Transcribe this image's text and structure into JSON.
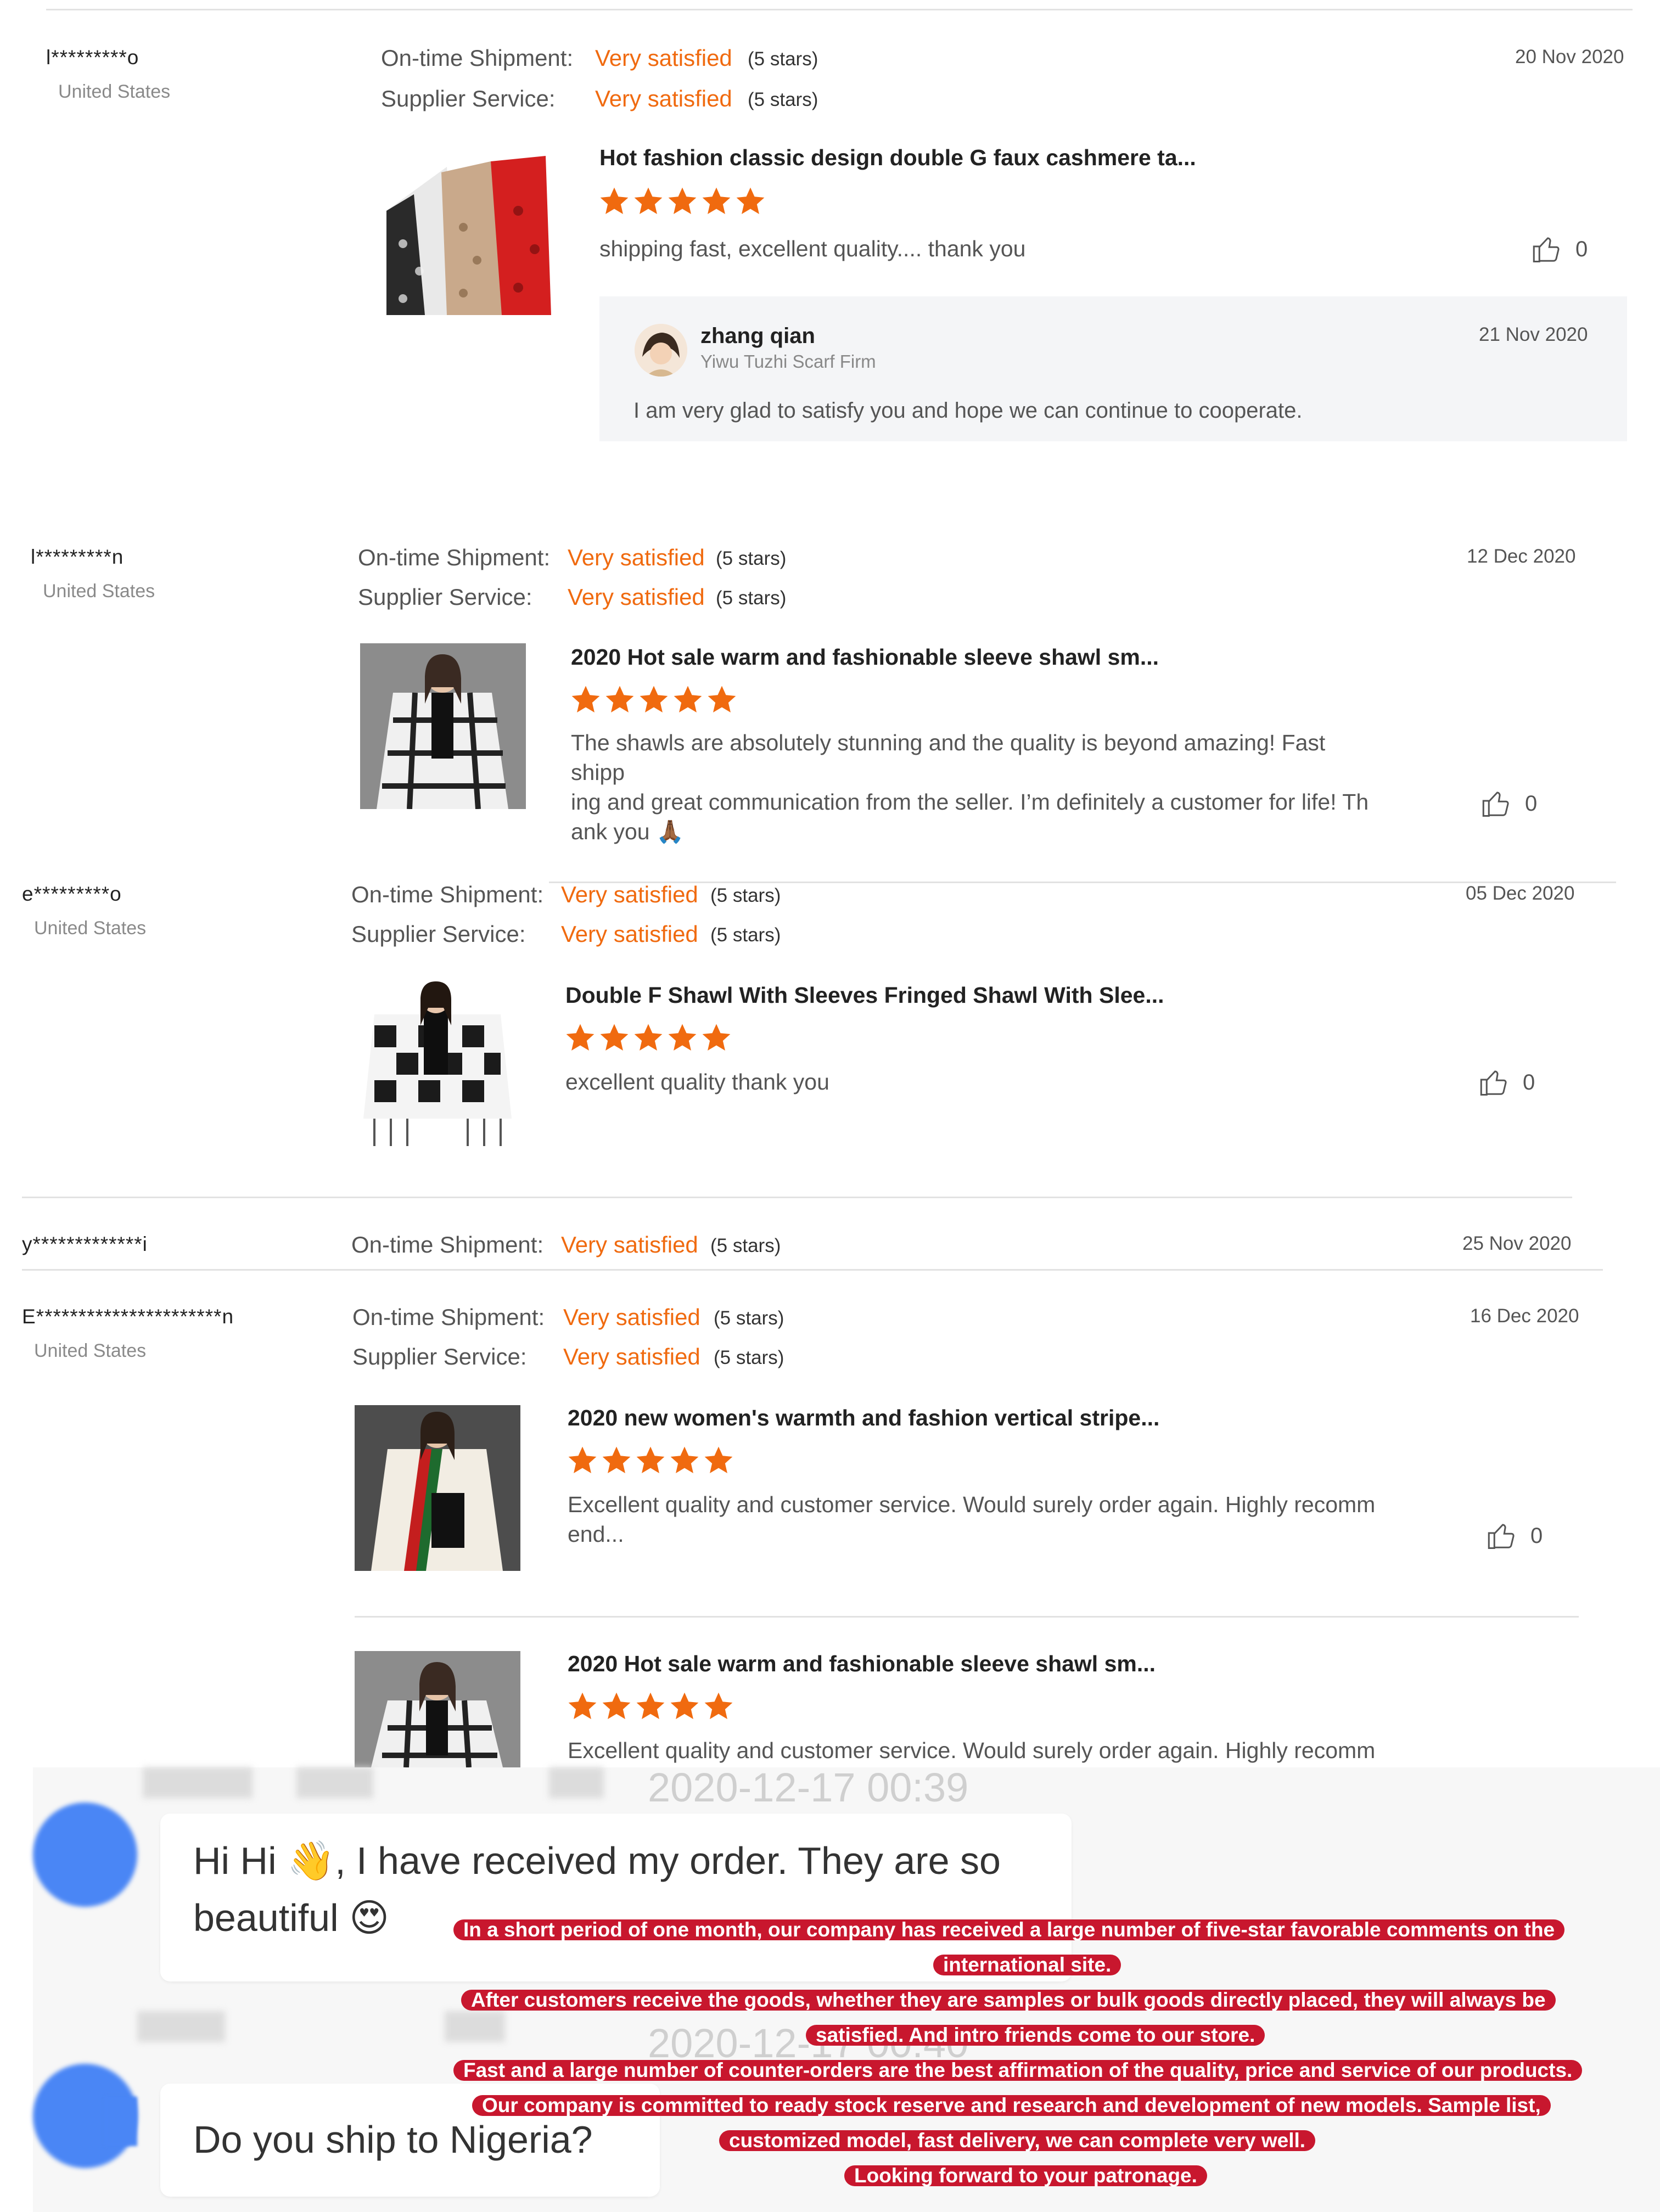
{
  "reviews": [
    {
      "user": "l*********o",
      "country": "United States",
      "date": "20 Nov 2020",
      "ontime_label": "On-time Shipment:",
      "ontime_value": "Very satisfied",
      "ontime_stars": "(5 stars)",
      "service_label": "Supplier Service:",
      "service_value": "Very satisfied",
      "service_stars": "(5 stars)",
      "product_title": "Hot fashion classic design double G faux cashmere ta...",
      "rating": 5,
      "comment": "shipping fast, excellent quality.... thank you",
      "likes": "0",
      "reply": {
        "name": "zhang qian",
        "company": "Yiwu Tuzhi Scarf Firm",
        "date": "21 Nov 2020",
        "text": "I am very glad to satisfy you and hope we can continue to cooperate."
      }
    },
    {
      "user": "l*********n",
      "country": "United States",
      "date": "12 Dec 2020",
      "ontime_label": "On-time Shipment:",
      "ontime_value": "Very satisfied",
      "ontime_stars": "(5 stars)",
      "service_label": "Supplier Service:",
      "service_value": "Very satisfied",
      "service_stars": "(5 stars)",
      "product_title": "2020 Hot sale warm and fashionable sleeve shawl sm...",
      "rating": 5,
      "comment_lines": [
        "The shawls are absolutely stunning and the quality is beyond amazing! Fast shipp",
        "ing and great communication from the seller. I’m definitely a customer for life! Th",
        "ank you 🙏🏾"
      ],
      "likes": "0"
    },
    {
      "user": "e*********o",
      "country": "United States",
      "date": "05 Dec 2020",
      "ontime_label": "On-time Shipment:",
      "ontime_value": "Very satisfied",
      "ontime_stars": "(5 stars)",
      "service_label": "Supplier Service:",
      "service_value": "Very satisfied",
      "service_stars": "(5 stars)",
      "product_title": "Double F Shawl With Sleeves Fringed Shawl With Slee...",
      "rating": 5,
      "comment": "excellent quality thank you",
      "likes": "0"
    },
    {
      "user": "y*************i",
      "date": "25 Nov 2020",
      "ontime_label": "On-time Shipment:",
      "ontime_value": "Very satisfied",
      "ontime_stars": "(5 stars)"
    },
    {
      "user": "E**********************n",
      "country": "United States",
      "date": "16 Dec 2020",
      "ontime_label": "On-time Shipment:",
      "ontime_value": "Very satisfied",
      "ontime_stars": "(5 stars)",
      "service_label": "Supplier Service:",
      "service_value": "Very satisfied",
      "service_stars": "(5 stars)",
      "product_title": "2020 new women's warmth and fashion vertical stripe...",
      "rating": 5,
      "comment_lines": [
        "Excellent quality and customer service. Would surely order again. Highly recomm",
        "end..."
      ],
      "likes": "0",
      "product2_title": "2020 Hot sale warm and fashionable sleeve shawl sm...",
      "rating2": 5,
      "comment2": "Excellent quality and customer service. Would surely order again. Highly recomm"
    }
  ],
  "chat": {
    "timestamp1": "2020-12-17 00:39",
    "message1_line1": "Hi Hi 👋, I have received my order. They are so",
    "message1_line2": "beautiful 😍",
    "timestamp2": "2020-12-17 00:40",
    "message2": "Do you ship to Nigeria?"
  },
  "banner": {
    "lines": [
      "In a short period of one month, our company has received a large number of five-star favorable comments on the",
      "international site.",
      "After customers receive the goods, whether they are samples or bulk goods directly placed, they will always be",
      "satisfied. And intro friends come to our store.",
      "Fast and a large number of counter-orders are the best affirmation of the quality, price and service of our products.",
      "Our company is committed to ready stock reserve and research and development of new models. Sample list,",
      "customized model, fast delivery, we can complete very well.",
      "Looking forward to your patronage."
    ]
  },
  "colors": {
    "accent": "#f06a0f",
    "banner": "#c8172e",
    "avatar": "#4a86f5"
  }
}
